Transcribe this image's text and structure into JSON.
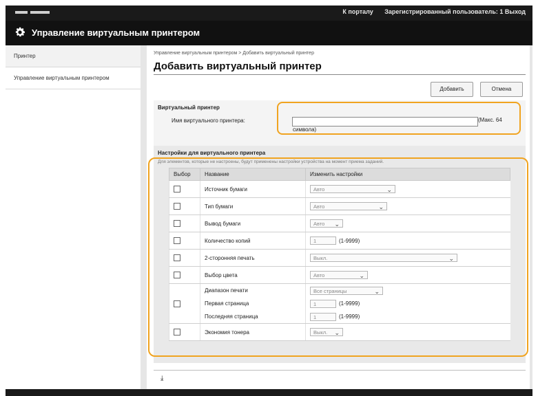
{
  "topbar": {
    "portal_link": "К порталу",
    "user_status": "Зарегистрированный пользователь: 1 Выход"
  },
  "app": {
    "title": "Управление виртуальным принтером"
  },
  "sidebar": {
    "items": [
      {
        "label": "Принтер"
      },
      {
        "label": "Управление виртуальным принтером"
      }
    ]
  },
  "main": {
    "breadcrumb": "Управление виртуальным принтером > Добавить виртуальный принтер",
    "page_title": "Добавить виртуальный принтер",
    "add_button": "Добавить",
    "cancel_button": "Отмена"
  },
  "virtual_printer": {
    "section_title": "Виртуальный принтер",
    "name_label": "Имя виртуального принтера:",
    "name_value": "",
    "hint_line1": "(Макс. 64",
    "hint_line2": "символа)"
  },
  "settings": {
    "section_title": "Настройки для виртуального принтера",
    "note": "Для элементов, которые не настроены, будут применены настройки устройства на момент приема заданий.",
    "columns": {
      "select": "Выбор",
      "name": "Название",
      "change": "Изменить настройки"
    },
    "rows": {
      "paper_source": {
        "label": "Источник бумаги",
        "value": "Авто"
      },
      "paper_type": {
        "label": "Тип бумаги",
        "value": "Авто"
      },
      "paper_output": {
        "label": "Вывод бумаги",
        "value": "Авто"
      },
      "copies": {
        "label": "Количество копий",
        "value": "1",
        "range": "(1-9999)"
      },
      "duplex": {
        "label": "2-сторонняя печать",
        "value": "Выкл."
      },
      "color": {
        "label": "Выбор цвета",
        "value": "Авто"
      },
      "print_range": {
        "label": "Диапазон печати",
        "value": "Все страницы"
      },
      "first_page": {
        "label": "Первая страница",
        "value": "1",
        "range": "(1-9999)"
      },
      "last_page": {
        "label": "Последняя страница",
        "value": "1",
        "range": "(1-9999)"
      },
      "toner_saving": {
        "label": "Экономия тонера",
        "value": "Выкл."
      }
    }
  },
  "colors": {
    "callout": "#f0a31f",
    "header_bg": "#111111",
    "table_header_bg": "#dcdcdc"
  },
  "icons": {
    "app": "gear-icon",
    "dropdown": "chevron-down-icon",
    "collapse": "collapse-top-icon"
  }
}
